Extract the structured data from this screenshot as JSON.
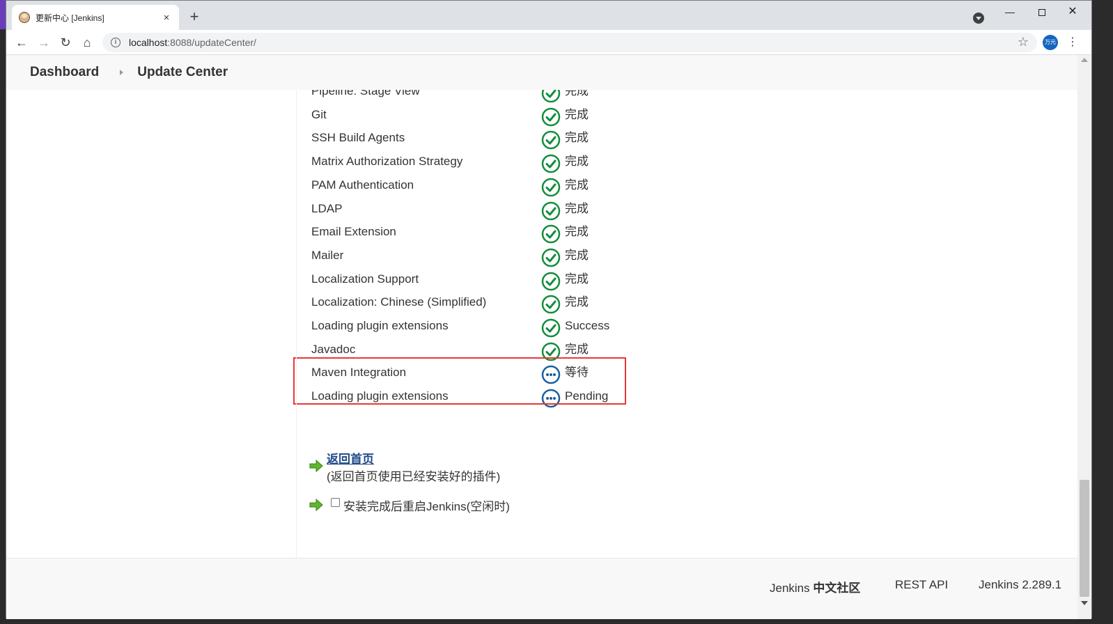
{
  "browser": {
    "tab_title": "更新中心 [Jenkins]",
    "tab_close": "×",
    "new_tab": "+",
    "url_host": "localhost",
    "url_path": ":8088/updateCenter/",
    "profile_label": "万元",
    "nav": {
      "back": "←",
      "forward": "→",
      "reload": "↻",
      "home": "⌂",
      "star": "☆",
      "menu": "⋮",
      "minimize": "—",
      "close": "✕"
    }
  },
  "breadcrumb": {
    "items": [
      "Dashboard",
      "Update Center"
    ]
  },
  "plugins": [
    {
      "name": "Pipeline: Stage View",
      "status": "完成",
      "state": "success"
    },
    {
      "name": "Git",
      "status": "完成",
      "state": "success"
    },
    {
      "name": "SSH Build Agents",
      "status": "完成",
      "state": "success"
    },
    {
      "name": "Matrix Authorization Strategy",
      "status": "完成",
      "state": "success"
    },
    {
      "name": "PAM Authentication",
      "status": "完成",
      "state": "success"
    },
    {
      "name": "LDAP",
      "status": "完成",
      "state": "success"
    },
    {
      "name": "Email Extension",
      "status": "完成",
      "state": "success"
    },
    {
      "name": "Mailer",
      "status": "完成",
      "state": "success"
    },
    {
      "name": "Localization Support",
      "status": "完成",
      "state": "success"
    },
    {
      "name": "Localization: Chinese (Simplified)",
      "status": "完成",
      "state": "success"
    },
    {
      "name": "Loading plugin extensions",
      "status": "Success",
      "state": "success"
    },
    {
      "name": "Javadoc",
      "status": "完成",
      "state": "success"
    },
    {
      "name": "Maven Integration",
      "status": "等待",
      "state": "pending"
    },
    {
      "name": "Loading plugin extensions",
      "status": "Pending",
      "state": "pending"
    }
  ],
  "actions": {
    "back_home_link": "返回首页",
    "back_home_note": "(返回首页使用已经安装好的插件)",
    "restart_label": "安装完成后重启Jenkins(空闲时)"
  },
  "footer": {
    "community_prefix": "Jenkins ",
    "community_suffix": "中文社区",
    "rest_api": "REST API",
    "version": "Jenkins 2.289.1"
  },
  "colors": {
    "success": "#138d3c",
    "pending": "#1a5fa0",
    "highlight": "#e53935",
    "link": "#204a87"
  }
}
